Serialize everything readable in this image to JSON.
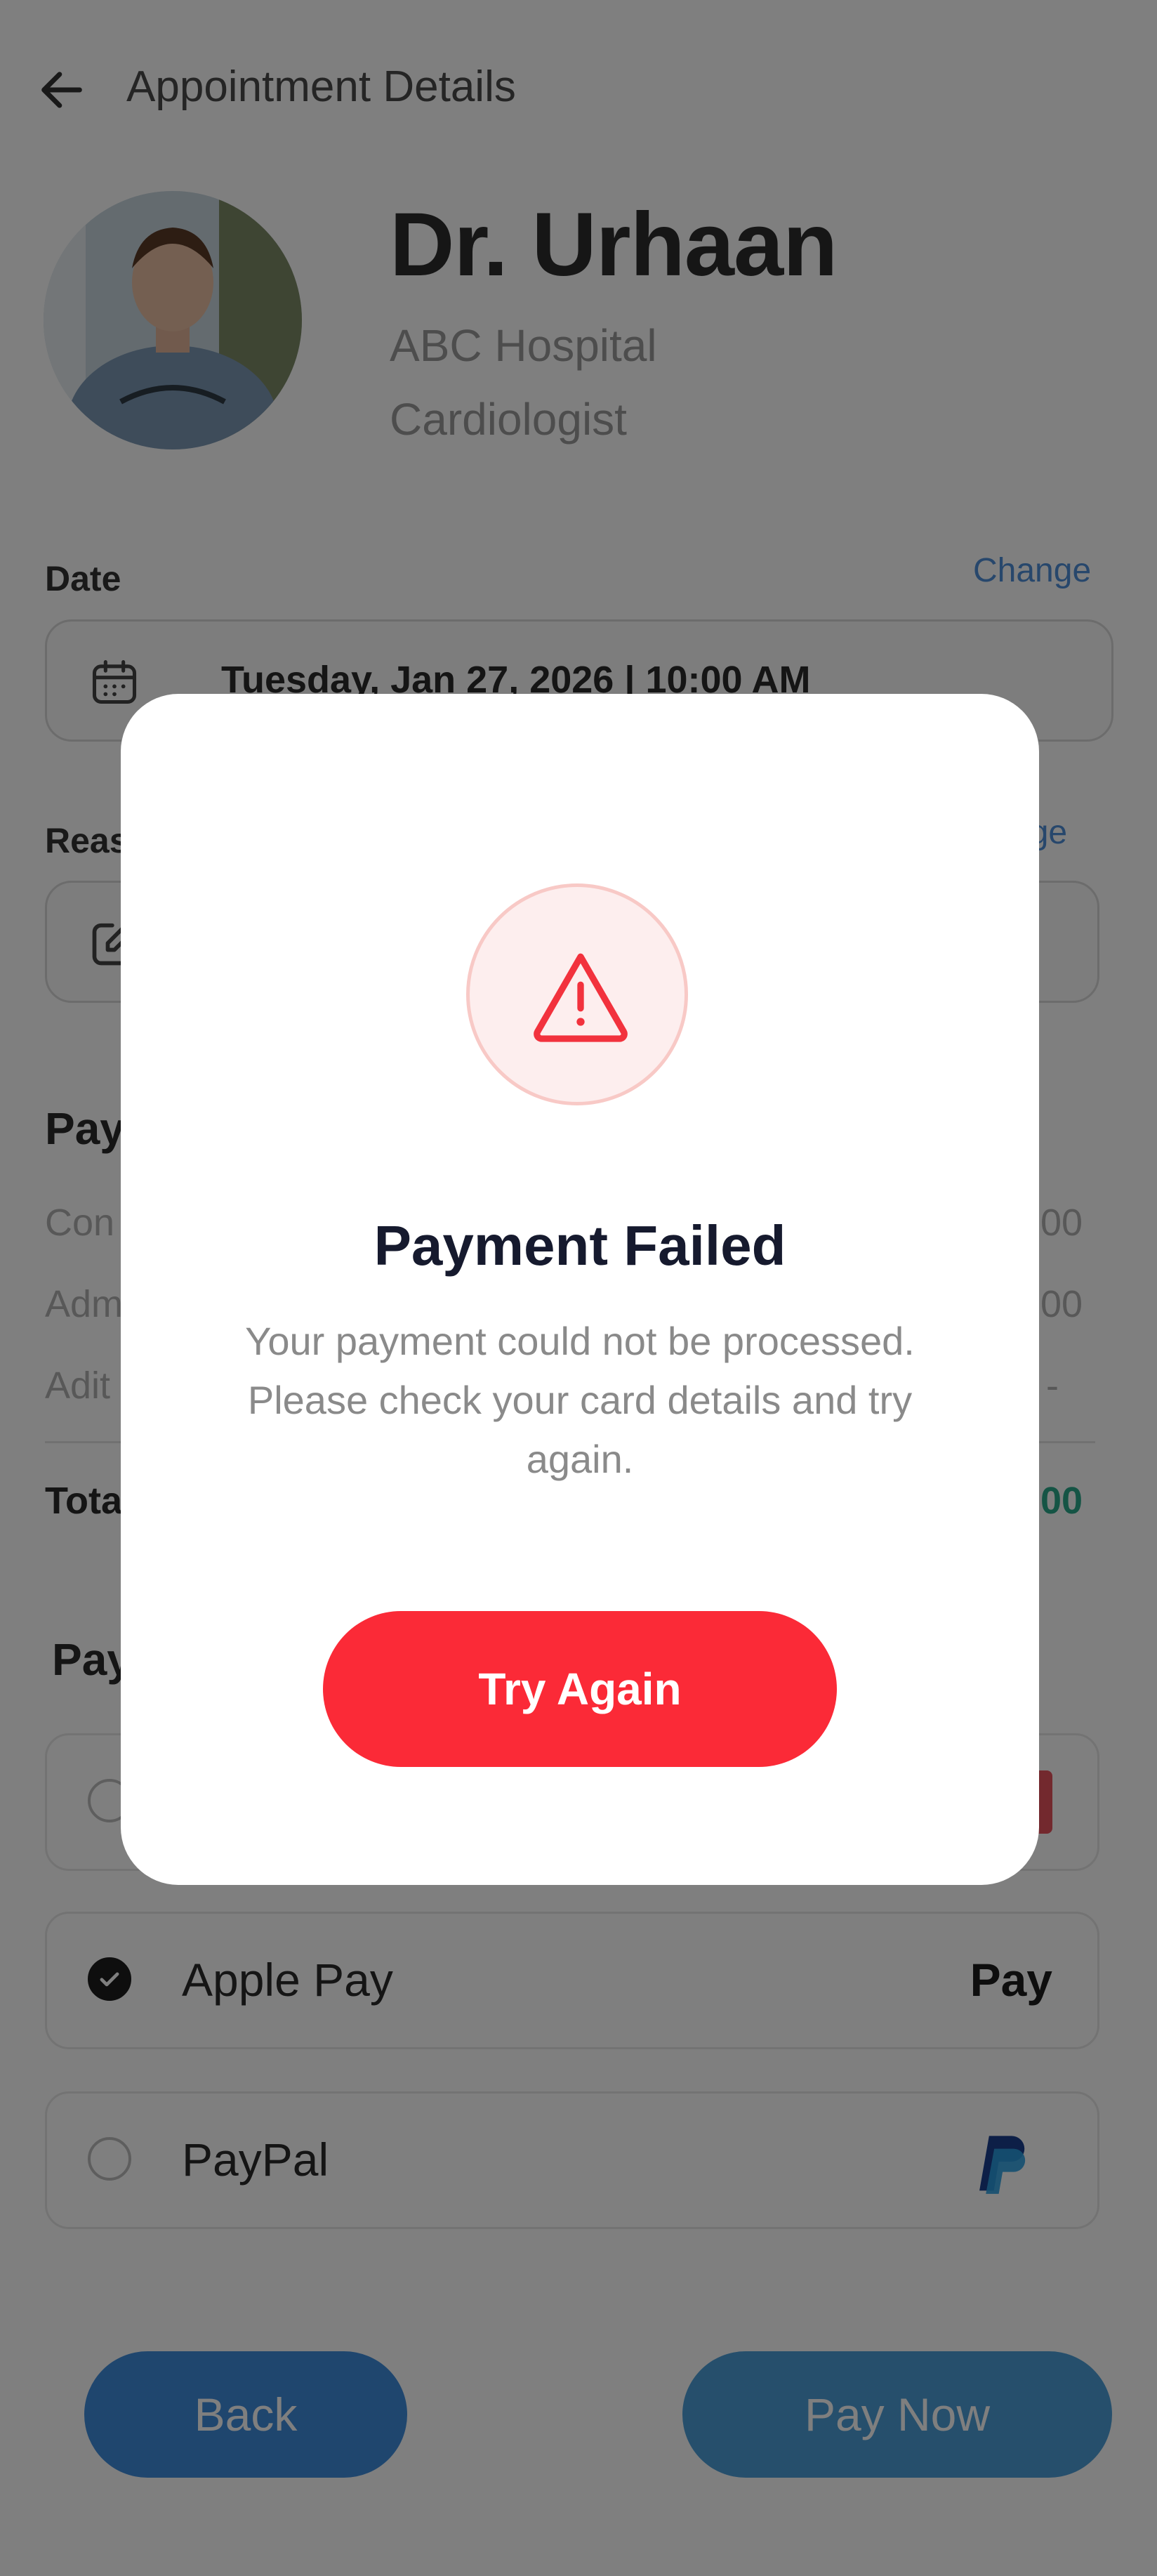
{
  "header": {
    "title": "Appointment Details"
  },
  "doctor": {
    "name": "Dr. Urhaan",
    "hospital": "ABC Hospital",
    "specialty": "Cardiologist"
  },
  "date_section": {
    "label": "Date",
    "change_label": "Change",
    "value": "Tuesday, Jan 27, 2026 | 10:00 AM"
  },
  "reason_section": {
    "label": "Reas",
    "change_label": "nge"
  },
  "payment_detail": {
    "title": "Pay",
    "rows": [
      {
        "label": "Con",
        "value": "00"
      },
      {
        "label": "Adm",
        "value": "00"
      },
      {
        "label": "Adit",
        "value": "-"
      }
    ],
    "total_label": "Tota",
    "total_value": "00"
  },
  "payment_methods": {
    "title": "Pay",
    "items": [
      {
        "label": "",
        "selected": false
      },
      {
        "label": "Apple Pay",
        "selected": true,
        "logo_text": "Pay"
      },
      {
        "label": "PayPal",
        "selected": false
      }
    ]
  },
  "footer": {
    "back_label": "Back",
    "pay_label": "Pay Now"
  },
  "modal": {
    "title": "Payment Failed",
    "message": "Your payment could not be processed. Please check your card details and try again.",
    "button_label": "Try Again",
    "icon": "warning-triangle-icon"
  },
  "colors": {
    "accent_red": "#fb2a37",
    "link_blue": "#4f8fd8",
    "primary_blue": "#3e8ddd",
    "total_green": "#2aa88a"
  }
}
